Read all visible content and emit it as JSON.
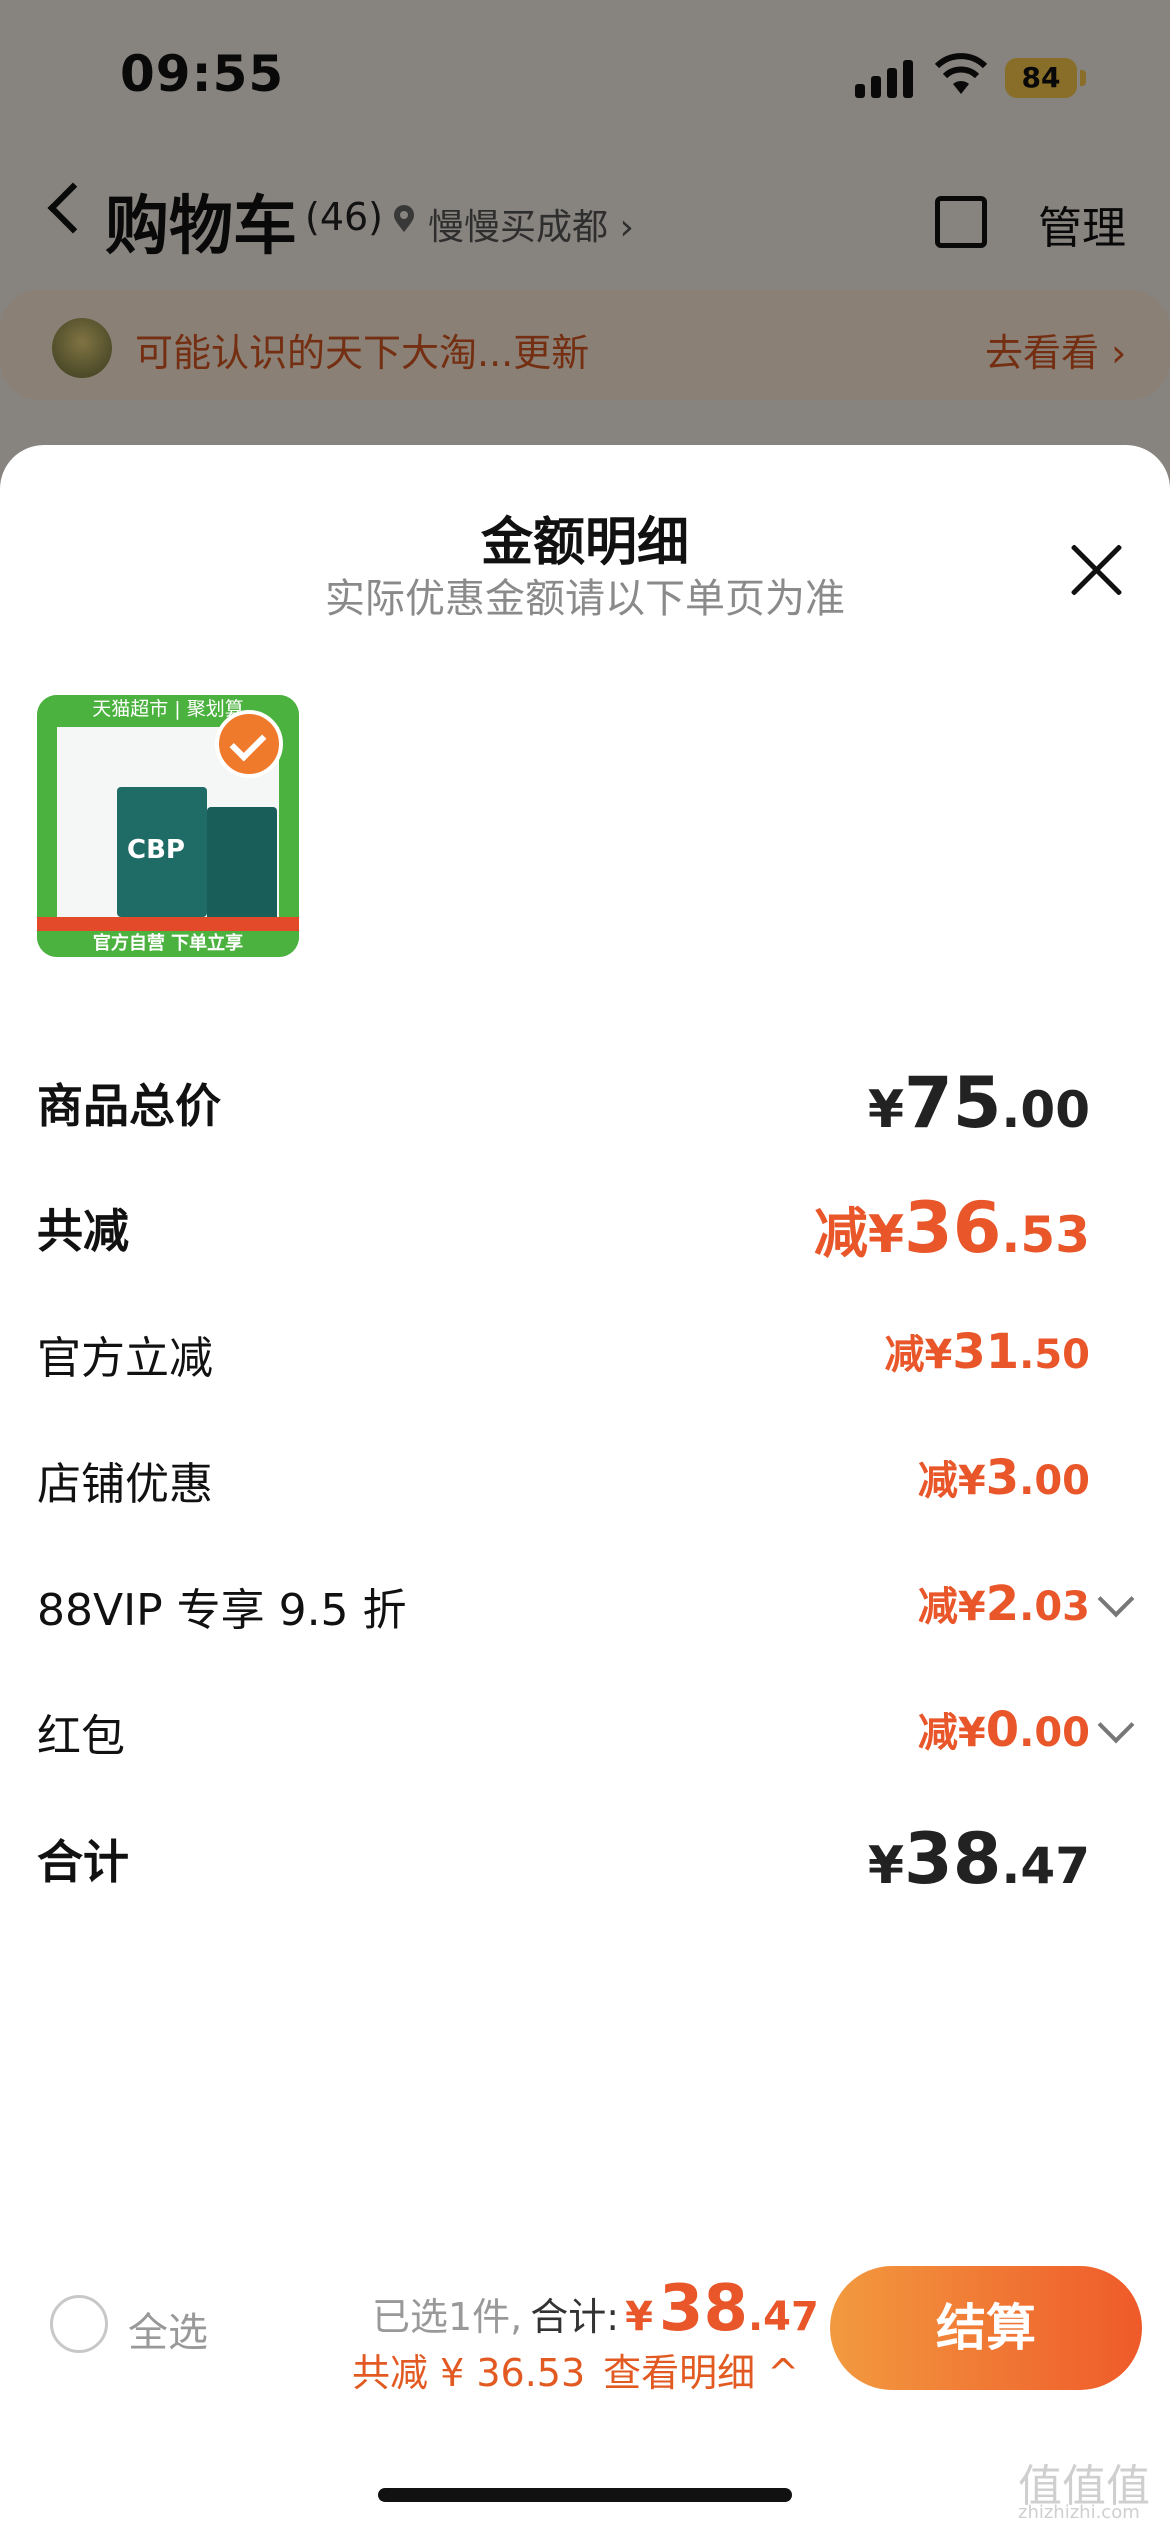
{
  "status_bar": {
    "time": "09:55",
    "battery": "84"
  },
  "nav": {
    "back_icon": "chevron-left-icon",
    "title": "购物车",
    "count": "(46)",
    "location": "慢慢买成都 ›",
    "manage": "管理",
    "copy_icon": "copy-icon"
  },
  "banner": {
    "text": "可能认识的天下大淘...更新",
    "link": "去看看 ›"
  },
  "sheet": {
    "title": "金额明细",
    "subtitle": "实际优惠金额请以下单页为准",
    "close_icon": "close-icon",
    "product": {
      "top_banner": "天猫超市 | 聚划算",
      "brand": "CBP",
      "bottom_banner": "官方自营 下单立享"
    },
    "rows": [
      {
        "label": "商品总价",
        "prefix": "",
        "currency": "¥",
        "int": "75",
        "dec": ".00"
      },
      {
        "label": "共减",
        "prefix": "减",
        "currency": "¥",
        "int": "36",
        "dec": ".53"
      },
      {
        "label": "官方立减",
        "prefix": "减",
        "currency": "¥",
        "int": "31",
        "dec": ".50"
      },
      {
        "label": "店铺优惠",
        "prefix": "减",
        "currency": "¥",
        "int": "3",
        "dec": ".00"
      },
      {
        "label": "88VIP 专享 9.5 折",
        "prefix": "减",
        "currency": "¥",
        "int": "2",
        "dec": ".03"
      },
      {
        "label": "红包",
        "prefix": "减",
        "currency": "¥",
        "int": "0",
        "dec": ".00"
      },
      {
        "label": "合计",
        "prefix": "",
        "currency": "¥",
        "int": "38",
        "dec": ".47"
      }
    ]
  },
  "bottom_bar": {
    "select_all": "全选",
    "selected_text": "已选1件,",
    "total_label": "合计:",
    "total_currency": "¥",
    "total_int": "38",
    "total_dec": ".47",
    "reduced_text": "共减 ¥ 36.53",
    "detail_link": "查看明细 ^",
    "checkout": "结算"
  },
  "watermark": {
    "text": "值值值",
    "sub": "zhizhizhi.com"
  },
  "colors": {
    "accent": "#e8562a",
    "checkout_start": "#f29a3f",
    "checkout_end": "#ef5a2a"
  }
}
